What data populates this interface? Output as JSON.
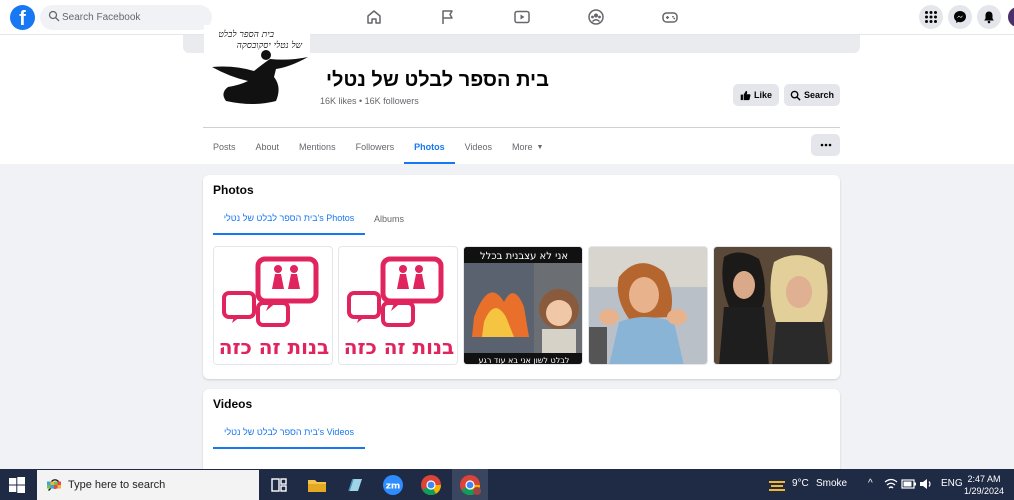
{
  "topbar": {
    "logo": "f",
    "search_placeholder": "Search Facebook",
    "nav_icons": [
      "home-icon",
      "flag-icon",
      "video-icon",
      "groups-icon",
      "gaming-icon"
    ],
    "right_icons": [
      "menu-grid-icon",
      "messenger-icon",
      "bell-icon"
    ]
  },
  "page": {
    "name": "בית הספר לבלט של נטלי",
    "stats": "16K likes • 16K followers",
    "like_label": "Like",
    "search_label": "Search",
    "tabs": [
      "Posts",
      "About",
      "Mentions",
      "Followers",
      "Photos",
      "Videos",
      "More"
    ],
    "active_tab": "Photos"
  },
  "photos": {
    "title": "Photos",
    "subtabs": [
      "בית הספר לבלט של נטלי's Photos",
      "Albums"
    ],
    "thumbs": [
      {
        "caption": "בנות זה כזה"
      },
      {
        "caption": "בנות זה כזה"
      },
      {
        "top_text": "אני לא עצבנית בכלל",
        "bottom_text": "לבלט לשון אני בא עוד רגע"
      },
      {
        "caption": ""
      },
      {
        "caption": ""
      }
    ]
  },
  "videos": {
    "title": "Videos",
    "subtab": "בית הספר לבלט של נטלי's Videos"
  },
  "taskbar": {
    "search_text": "Type here to search",
    "weather": "9°C",
    "weather_desc": "Smoke",
    "lang": "ENG",
    "time": "2:47 AM",
    "date": "1/29/2024",
    "zoom_label": "zm"
  }
}
